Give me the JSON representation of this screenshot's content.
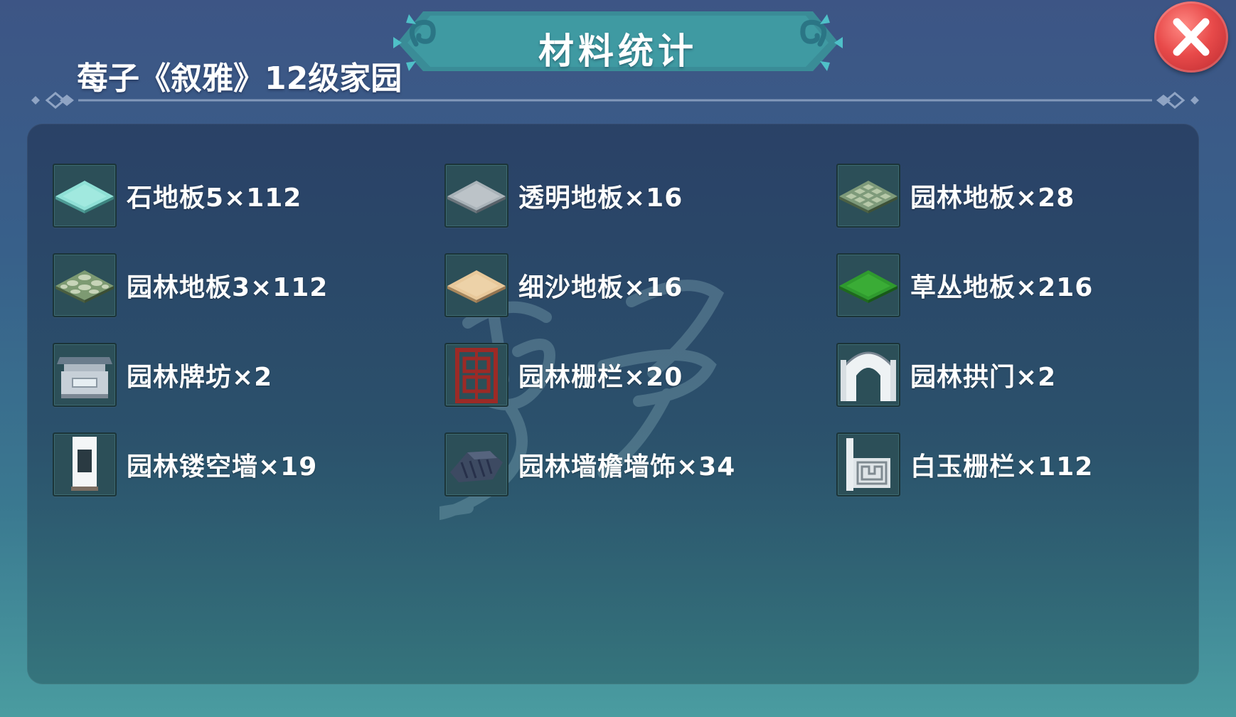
{
  "header": {
    "title": "材料统计",
    "subtitle": "莓子《叙雅》12级家园"
  },
  "close_button": {
    "icon": "close-icon",
    "color": "#e84a4a"
  },
  "watermark_text": "莓子",
  "items": [
    {
      "label": "石地板5×112",
      "icon": "stone-floor-icon"
    },
    {
      "label": "透明地板×16",
      "icon": "transparent-floor-icon"
    },
    {
      "label": "园林地板×28",
      "icon": "garden-floor-icon"
    },
    {
      "label": "园林地板3×112",
      "icon": "garden-pebble-floor-icon"
    },
    {
      "label": "细沙地板×16",
      "icon": "sand-floor-icon"
    },
    {
      "label": "草丛地板×216",
      "icon": "grass-floor-icon"
    },
    {
      "label": "园林牌坊×2",
      "icon": "garden-archway-icon"
    },
    {
      "label": "园林栅栏×20",
      "icon": "garden-fence-icon"
    },
    {
      "label": "园林拱门×2",
      "icon": "garden-arch-door-icon"
    },
    {
      "label": "园林镂空墙×19",
      "icon": "garden-lattice-wall-icon"
    },
    {
      "label": "园林墙檐墙饰×34",
      "icon": "wall-eave-icon"
    },
    {
      "label": "白玉栅栏×112",
      "icon": "white-jade-fence-icon"
    }
  ]
}
